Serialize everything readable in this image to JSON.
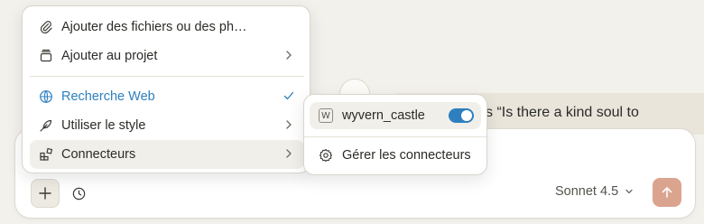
{
  "chat": {
    "message_text": "s “Is there a kind soul to"
  },
  "menu": {
    "items": [
      {
        "label": "Ajouter des fichiers ou des ph…",
        "icon": "paperclip-icon"
      },
      {
        "label": "Ajouter au projet",
        "icon": "project-box-icon"
      },
      {
        "label": "Recherche Web",
        "icon": "globe-icon"
      },
      {
        "label": "Utiliser le style",
        "icon": "feather-pen-icon"
      },
      {
        "label": "Connecteurs",
        "icon": "blocks-icon"
      }
    ]
  },
  "submenu": {
    "connector_name": "wyvern_castle",
    "connector_badge": "W",
    "connector_enabled": true,
    "manage_label": "Gérer les connecteurs"
  },
  "composer": {
    "model_label": "Sonnet 4.5"
  },
  "colors": {
    "accent_blue": "#2d7fbf",
    "send_button": "#dba48f",
    "background": "#f3f1ec"
  }
}
